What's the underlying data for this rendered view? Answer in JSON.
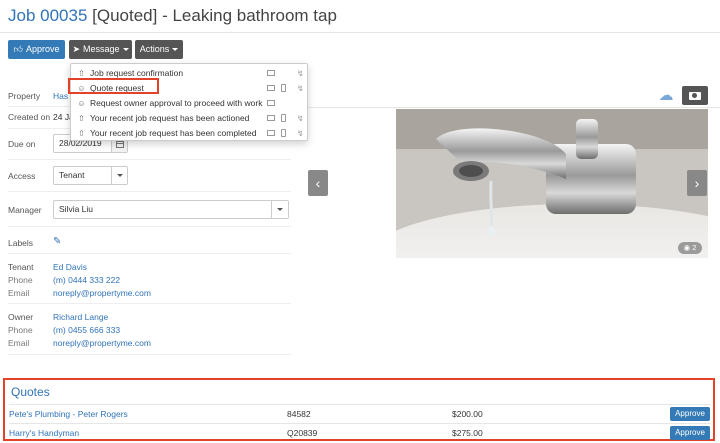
{
  "page": {
    "job_number": "Job 00035",
    "status": "[Quoted]",
    "title_rest": "- Leaking bathroom tap"
  },
  "toolbar": {
    "approve_label": "Approve",
    "message_label": "Message",
    "actions_label": "Actions"
  },
  "message_menu": {
    "items": [
      {
        "label": "Job request confirmation",
        "icon": "upload-icon",
        "email": true,
        "sms": false,
        "auto": true
      },
      {
        "label": "Quote request",
        "icon": "people-icon",
        "email": true,
        "sms": true,
        "auto": true
      },
      {
        "label": "Request owner approval to proceed with work",
        "icon": "people-icon",
        "email": true,
        "sms": false,
        "auto": false
      },
      {
        "label": "Your recent job request has been actioned",
        "icon": "upload-icon",
        "email": true,
        "sms": true,
        "auto": true
      },
      {
        "label": "Your recent job request has been completed",
        "icon": "upload-icon",
        "email": true,
        "sms": true,
        "auto": true
      }
    ]
  },
  "details": {
    "property_label": "Property",
    "property_value": "Has",
    "created_label": "Created on",
    "created_value": "24 Ja",
    "due_label": "Due on",
    "due_value": "28/02/2019",
    "access_label": "Access",
    "access_value": "Tenant",
    "manager_label": "Manager",
    "manager_value": "Silvia Liu",
    "labels_label": "Labels"
  },
  "tenant": {
    "role_label": "Tenant",
    "name": "Ed Davis",
    "phone_label": "Phone",
    "phone": "(m) 0444 333 222",
    "email_label": "Email",
    "email": "noreply@propertyme.com"
  },
  "owner": {
    "role_label": "Owner",
    "name": "Richard Lange",
    "phone_label": "Phone",
    "phone": "(m) 0455 666 333",
    "email_label": "Email",
    "email": "noreply@propertyme.com"
  },
  "photos": {
    "count": "2"
  },
  "quotes": {
    "title": "Quotes",
    "rows": [
      {
        "supplier": "Pete's Plumbing - Peter Rogers",
        "reference": "84582",
        "amount": "$200.00",
        "action": "Approve"
      },
      {
        "supplier": "Harry's Handyman",
        "reference": "Q20839",
        "amount": "$275.00",
        "action": "Approve"
      }
    ]
  },
  "colors": {
    "accent": "#337ab7",
    "highlight": "#e2412a",
    "dark_button": "#555555"
  }
}
